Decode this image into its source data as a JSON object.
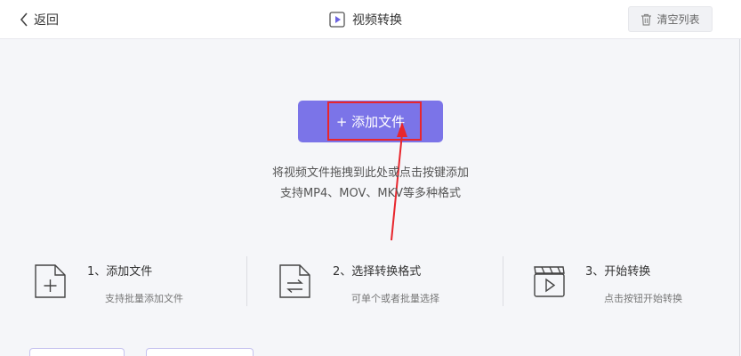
{
  "header": {
    "back_label": "返回",
    "title": "视频转换",
    "clear_label": "清空列表"
  },
  "main": {
    "add_button_label": "+ 添加文件",
    "hint_line1": "将视频文件拖拽到此处或点击按键添加",
    "hint_line2": "支持MP4、MOV、MKV等多种格式"
  },
  "steps": [
    {
      "title": "1、添加文件",
      "desc": "支持批量添加文件",
      "icon": "file-add-icon"
    },
    {
      "title": "2、选择转换格式",
      "desc": "可单个或者批量选择",
      "icon": "file-convert-icon"
    },
    {
      "title": "3、开始转换",
      "desc": "点击按钮开始转换",
      "icon": "video-play-icon"
    }
  ],
  "colors": {
    "accent": "#7b74e8",
    "annotation": "#e8262d"
  }
}
